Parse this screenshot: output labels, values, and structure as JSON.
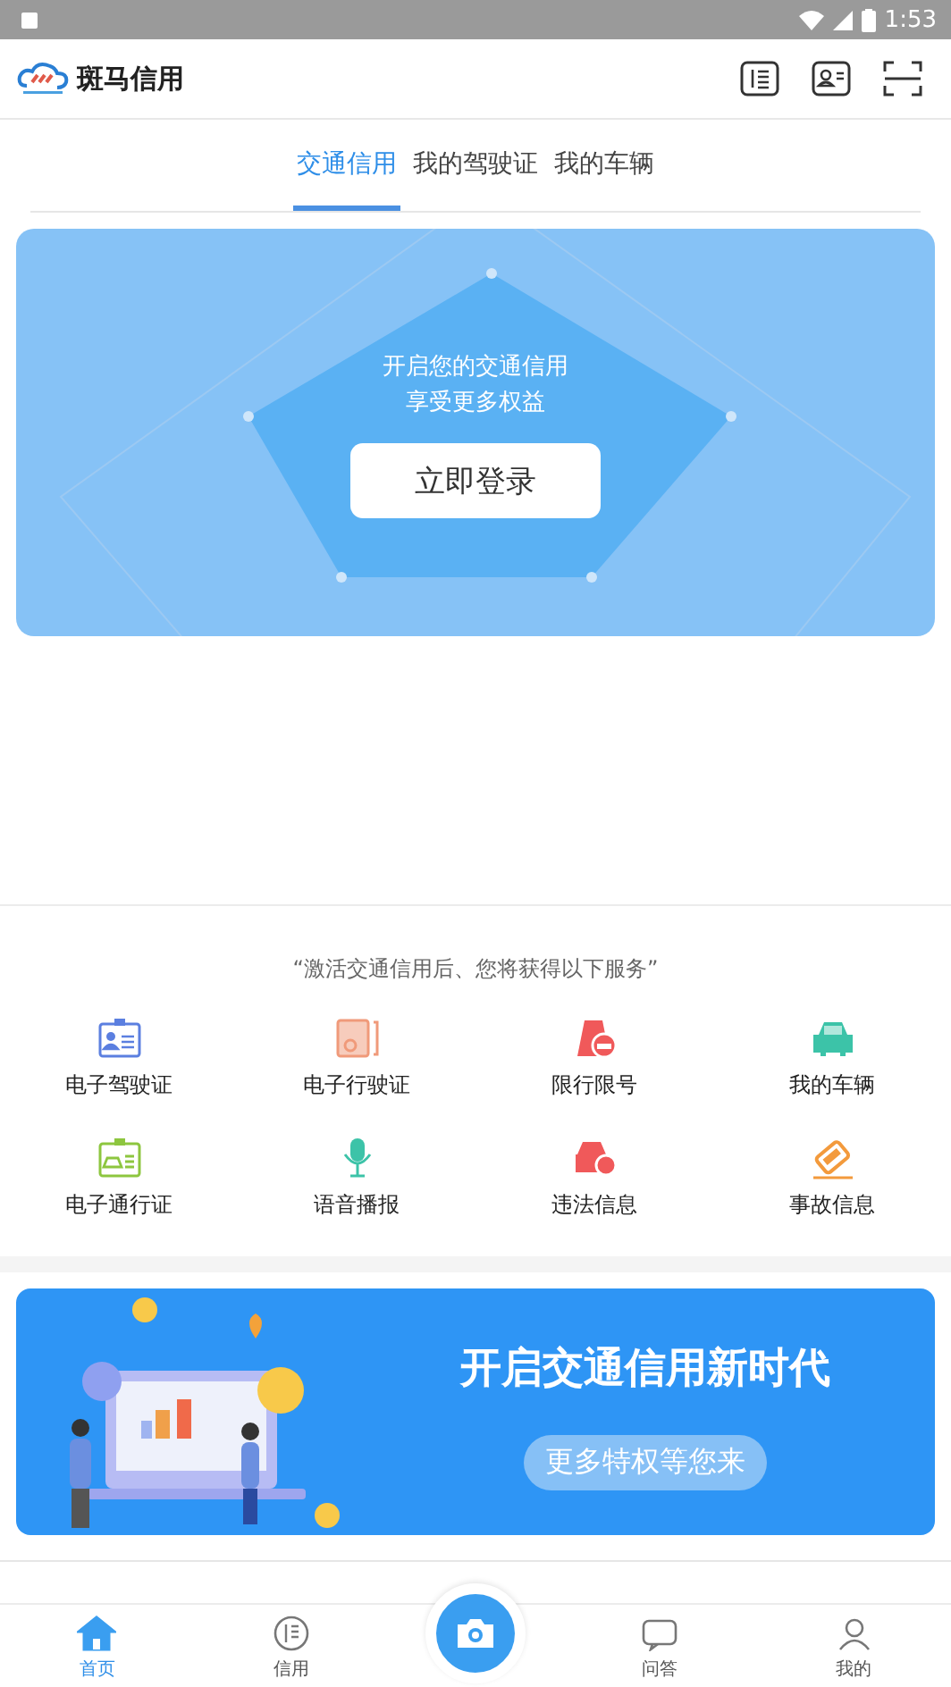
{
  "status_bar": {
    "time": "1:53"
  },
  "header": {
    "title": "斑马信用"
  },
  "tabs": [
    {
      "label": "交通信用",
      "selected": true
    },
    {
      "label": "我的驾驶证",
      "selected": false
    },
    {
      "label": "我的车辆",
      "selected": false
    }
  ],
  "credit_card": {
    "line_1": "开启您的交通信用",
    "line_2": "享受更多权益",
    "button": "立即登录"
  },
  "services": {
    "caption": "“激活交通信用后、您将获得以下服务”",
    "items": [
      {
        "label": "电子驾驶证",
        "kind": "license",
        "color": "#5b7fe0"
      },
      {
        "label": "电子行驶证",
        "kind": "permit",
        "color": "#f09a7a"
      },
      {
        "label": "限行限号",
        "kind": "limit",
        "color": "#f0595a"
      },
      {
        "label": "我的车辆",
        "kind": "car",
        "color": "#3cc3a8"
      },
      {
        "label": "电子通行证",
        "kind": "pass",
        "color": "#8dc63f"
      },
      {
        "label": "语音播报",
        "kind": "mic",
        "color": "#3cc3a8"
      },
      {
        "label": "违法信息",
        "kind": "violation",
        "color": "#f0595a"
      },
      {
        "label": "事故信息",
        "kind": "accident",
        "color": "#f39a3c"
      }
    ]
  },
  "banner": {
    "title": "开启交通信用新时代",
    "button": "更多特权等您来"
  },
  "bottom_nav": [
    {
      "label": "首页",
      "kind": "home",
      "selected": true
    },
    {
      "label": "信用",
      "kind": "credit",
      "selected": false
    },
    {
      "kind": "camera",
      "selected": false
    },
    {
      "label": "问答",
      "kind": "qa",
      "selected": false
    },
    {
      "label": "我的",
      "kind": "me",
      "selected": false
    }
  ]
}
